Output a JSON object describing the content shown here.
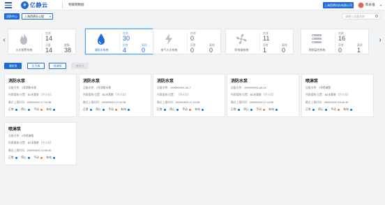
{
  "header": {
    "logo_mark": "e",
    "logo_text": "亿静云",
    "nav_title": "物联网数据",
    "company": "上海西德科技有限公司",
    "username": "陈永强",
    "caret": "▾"
  },
  "toolbar": {
    "project_tag": "消防中心",
    "select_value": "上海西德办公楼",
    "caret": "▾",
    "search_placeholder": "请输入设备名称"
  },
  "nav_arrows": {
    "left": "‹",
    "right": "›"
  },
  "categories": [
    {
      "name": "火灾报警系统",
      "icon": "flame-icon",
      "s1_label": "在线",
      "s1_value": "14",
      "s2_label": "离线",
      "s2_value": "",
      "s3_label": "计量",
      "s3_value": "14",
      "s4_label": "故障",
      "s4_value": "38"
    },
    {
      "name": "消防水系统",
      "icon": "water-drop-icon",
      "s1_label": "在线",
      "s1_value": "30",
      "s2_label": "",
      "s2_value": "",
      "s3_label": "异常",
      "s3_value": "4",
      "s4_label": "离线",
      "s4_value": "0"
    },
    {
      "name": "电气火灾系统",
      "icon": "lightning-icon",
      "s1_label": "在线",
      "s1_value": "0",
      "s2_label": "",
      "s2_value": "",
      "s3_label": "异常",
      "s3_value": "0",
      "s4_label": "离线",
      "s4_value": "0"
    },
    {
      "name": "防排烟系统",
      "icon": "fan-icon",
      "s1_label": "在线",
      "s1_value": "11",
      "s2_label": "",
      "s2_value": "",
      "s3_label": "异常",
      "s3_value": "1",
      "s4_label": "离线",
      "s4_value": "0"
    },
    {
      "name": "视频监控系统",
      "icon": "camera-grid-icon",
      "s1_label": "在线",
      "s1_value": "16",
      "s2_label": "",
      "s2_value": "",
      "s3_label": "异常",
      "s3_value": "0",
      "s4_label": "离线",
      "s4_value": "1"
    }
  ],
  "tabs": [
    "消防泵",
    "压力表",
    "喷淋泵",
    "液位计"
  ],
  "status_labels": {
    "normal": "正常",
    "stop": "停止",
    "manual": "手动",
    "power": "有电"
  },
  "colors": {
    "primary": "#1e6ad6",
    "blue_dot": "#1e6ad6",
    "orange_dot": "#f07a3c"
  },
  "devices": [
    {
      "title": "消防水泵",
      "name_label": "设备名称：",
      "name": "1号消防水泵",
      "loc_label": "所属楼栋/位置：",
      "loc": "B2水泵房",
      "loc_extra": "【供水泵】",
      "time_label": "最近上报时间：",
      "time": "2020/03/20 17:12:36",
      "dots": [
        "#1e6ad6",
        "#1e6ad6",
        "#f07a3c",
        "#1e6ad6"
      ]
    },
    {
      "title": "消防水泵",
      "name_label": "设备名称：",
      "name": "2号消防水泵",
      "loc_label": "所属楼栋/位置：",
      "loc": "B2水泵房",
      "loc_extra": "【供水泵】",
      "time_label": "最近上报时间：",
      "time": "2020/03/20 17:12:36",
      "dots": [
        "#1e6ad6",
        "#1e6ad6",
        "#f07a3c",
        "#1e6ad6"
      ]
    },
    {
      "title": "消防水泵",
      "name_label": "设备名称：",
      "name": "1000000011-64-7",
      "loc_label": "所属楼栋/位置：",
      "loc": "",
      "loc_extra": "【供水泵】",
      "time_label": "最近上报时间：",
      "time": "2020/03/20 17:12:59",
      "dots": [
        "#1e6ad6",
        "#1e6ad6",
        "#f07a3c",
        "#1e6ad6"
      ]
    },
    {
      "title": "消防水泵",
      "name_label": "设备名称：",
      "name": "1000000011-64-11",
      "loc_label": "所属楼栋/位置：",
      "loc": "B2水泵房",
      "loc_extra": "【供水泵】",
      "time_label": "最近上报时间：",
      "time": "2020/03/20 17:12:59",
      "dots": [
        "#1e6ad6",
        "#1e6ad6",
        "#f07a3c",
        "#1e6ad6"
      ]
    },
    {
      "title": "喷淋泵",
      "name_label": "设备名称：",
      "name": "1号喷淋泵",
      "loc_label": "所属楼栋/位置：",
      "loc": "B2水泵房",
      "loc_extra": "【供水泵】",
      "time_label": "最近上报时间：",
      "time": "2020/03/20 15:40:30",
      "dots": [
        "#1e6ad6",
        "#1e6ad6",
        "#f07a3c",
        "#1e6ad6"
      ]
    },
    {
      "title": "喷淋泵",
      "name_label": "设备名称：",
      "name": "2号喷淋泵",
      "loc_label": "所属楼栋/位置：",
      "loc": "B2水泵房",
      "loc_extra": "【供水泵】",
      "time_label": "最近上报时间：",
      "time": "2020/03/20 15:40:30",
      "dots": [
        "#1e6ad6",
        "#1e6ad6",
        "#f07a3c",
        "#1e6ad6"
      ]
    }
  ]
}
